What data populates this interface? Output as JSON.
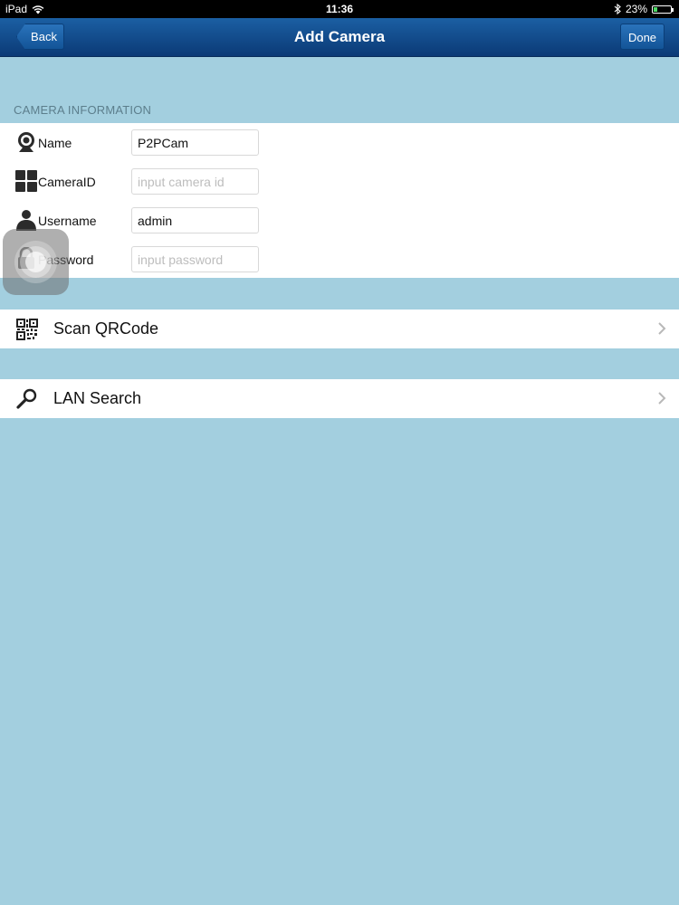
{
  "status_bar": {
    "device": "iPad",
    "time": "11:36",
    "battery": "23%",
    "battery_level": 0.23
  },
  "nav": {
    "title": "Add Camera",
    "back_label": "Back",
    "done_label": "Done"
  },
  "section": {
    "header": "CAMERA INFORMATION"
  },
  "form": {
    "name": {
      "label": "Name",
      "value": "P2PCam",
      "placeholder": "",
      "icon": "webcam-icon"
    },
    "camera_id": {
      "label": "CameraID",
      "value": "",
      "placeholder": "input camera id",
      "icon": "grid-icon"
    },
    "username": {
      "label": "Username",
      "value": "admin",
      "placeholder": "",
      "icon": "user-icon"
    },
    "password": {
      "label": "Password",
      "value": "",
      "placeholder": "input password",
      "icon": "lock-icon"
    }
  },
  "actions": {
    "scan_qr": {
      "label": "Scan QRCode",
      "icon": "qr-code-icon"
    },
    "lan_search": {
      "label": "LAN Search",
      "icon": "magnifier-icon"
    }
  },
  "colors": {
    "background": "#a3cfdf",
    "nav_top": "#1b5fa3",
    "nav_bottom": "#0b3a76",
    "section_header": "#5c7e8c"
  }
}
